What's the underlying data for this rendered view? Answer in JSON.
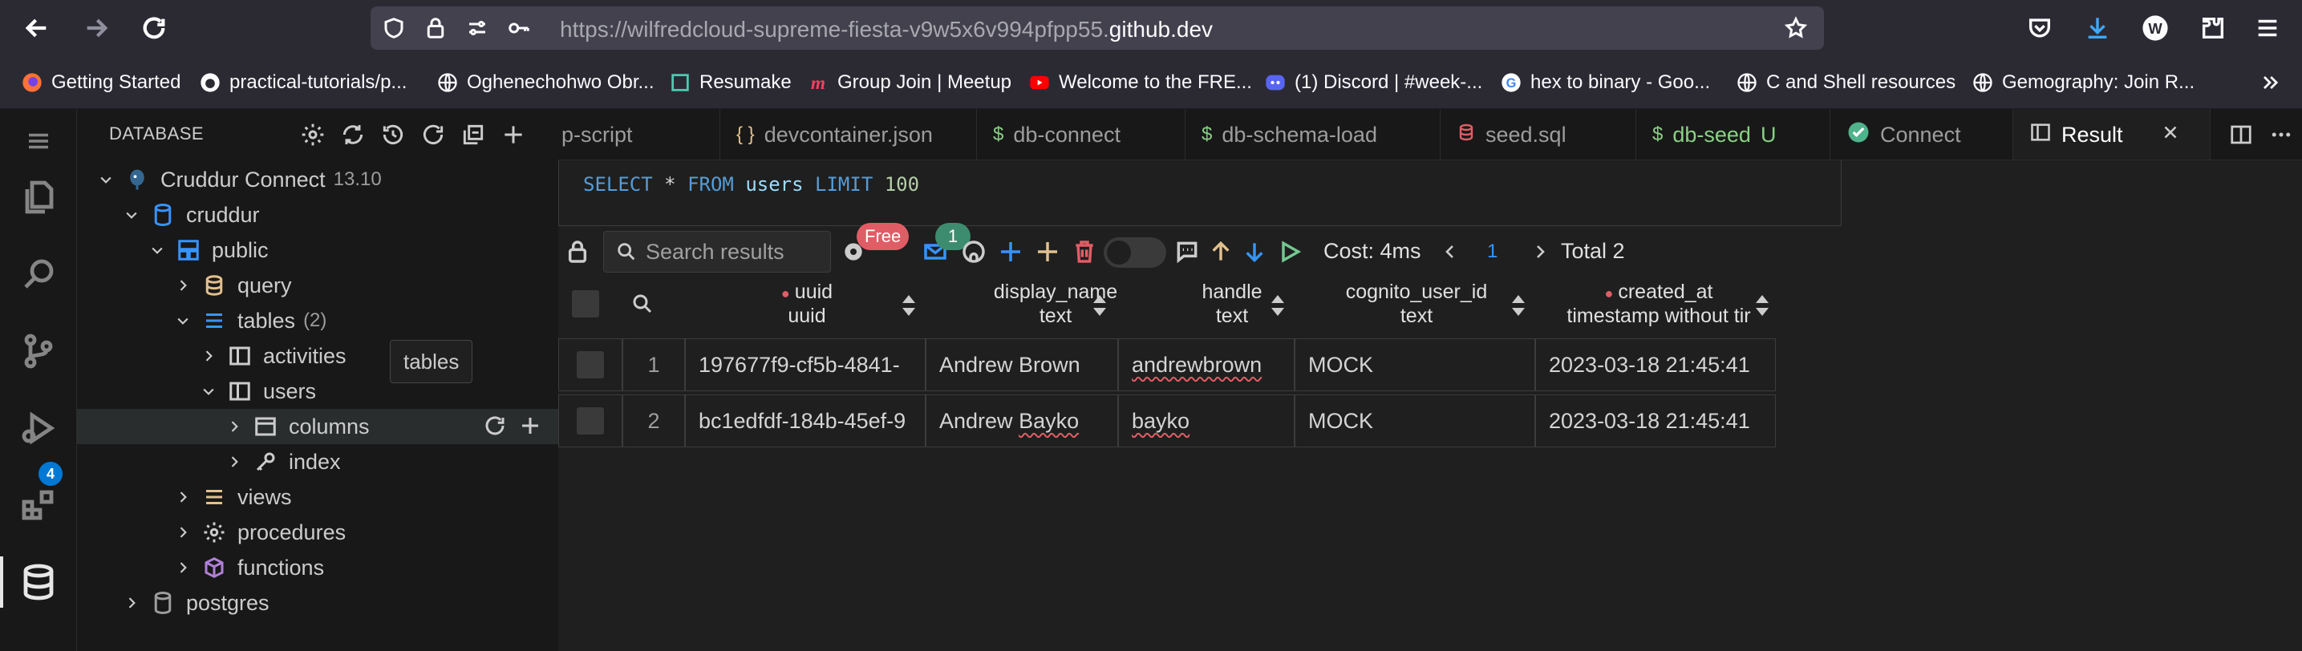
{
  "browser": {
    "url_prefix": "https://wilfredcloud-supreme-fiesta-v9w5x6v994pfpp55.",
    "url_domain": "github.dev",
    "bookmarks": [
      {
        "label": "Getting Started",
        "icon": "firefox-icon"
      },
      {
        "label": "practical-tutorials/p...",
        "icon": "github-icon"
      },
      {
        "label": "Oghenechohwo Obr...",
        "icon": "globe-icon"
      },
      {
        "label": "Resumake",
        "icon": "resumake-icon"
      },
      {
        "label": "Group Join | Meetup",
        "icon": "meetup-icon"
      },
      {
        "label": "Welcome to the FRE...",
        "icon": "youtube-icon"
      },
      {
        "label": "(1) Discord | #week-...",
        "icon": "discord-icon"
      },
      {
        "label": "hex to binary - Goo...",
        "icon": "google-icon"
      },
      {
        "label": "C and Shell resources",
        "icon": "globe-icon"
      },
      {
        "label": "Gemography: Join R...",
        "icon": "globe-icon"
      }
    ]
  },
  "activity_bar": {
    "badge_count": "4"
  },
  "sidebar": {
    "title": "DATABASE",
    "tooltip": "tables",
    "tree": {
      "connection": {
        "label": "Cruddur Connect",
        "version": "13.10"
      },
      "database": "cruddur",
      "schema": "public",
      "query": "query",
      "tables": {
        "label": "tables",
        "count": "(2)"
      },
      "activities": "activities",
      "users": "users",
      "columns": "columns",
      "index": "index",
      "views": "views",
      "procedures": "procedures",
      "functions": "functions",
      "postgres": "postgres"
    }
  },
  "tabs": [
    {
      "label": "p-script",
      "icon": ""
    },
    {
      "label": "devcontainer.json",
      "icon": "{}"
    },
    {
      "label": "db-connect",
      "icon": "$"
    },
    {
      "label": "db-schema-load",
      "icon": "$"
    },
    {
      "label": "seed.sql",
      "icon": "db"
    },
    {
      "label": "db-seed",
      "icon": "$",
      "status": "U"
    },
    {
      "label": "Connect",
      "icon": "check"
    },
    {
      "label": "Result",
      "icon": "panel"
    }
  ],
  "query": {
    "kw_select": "SELECT",
    "star": "*",
    "kw_from": "FROM",
    "table": "users",
    "kw_limit": "LIMIT",
    "limit": "100"
  },
  "results_toolbar": {
    "search_placeholder": "Search results",
    "free_badge": "Free",
    "mail_count": "1",
    "cost": "Cost: 4ms",
    "page": "1",
    "total": "Total 2"
  },
  "columns": [
    {
      "name": "uuid",
      "type": "uuid",
      "required": true
    },
    {
      "name": "display_name",
      "type": "text",
      "required": false
    },
    {
      "name": "handle",
      "type": "text",
      "required": false
    },
    {
      "name": "cognito_user_id",
      "type": "text",
      "required": false
    },
    {
      "name": "created_at",
      "type": "timestamp without tir",
      "required": true
    }
  ],
  "rows": [
    {
      "index": "1",
      "uuid": "197677f9-cf5b-4841-",
      "display_name": "Andrew Brown",
      "handle": "andrewbrown",
      "cognito_user_id": "MOCK",
      "created_at": "2023-03-18 21:45:41"
    },
    {
      "index": "2",
      "uuid": "bc1edfdf-184b-45ef-9",
      "display_name": "Andrew Bayko",
      "handle": "bayko",
      "cognito_user_id": "MOCK",
      "created_at": "2023-03-18 21:45:41"
    }
  ],
  "colors": {
    "accent_blue": "#3794ff",
    "add_green": "#4ec9b0",
    "yellow": "#e2c08d",
    "red": "#e05d65",
    "play_green": "#73c991"
  }
}
